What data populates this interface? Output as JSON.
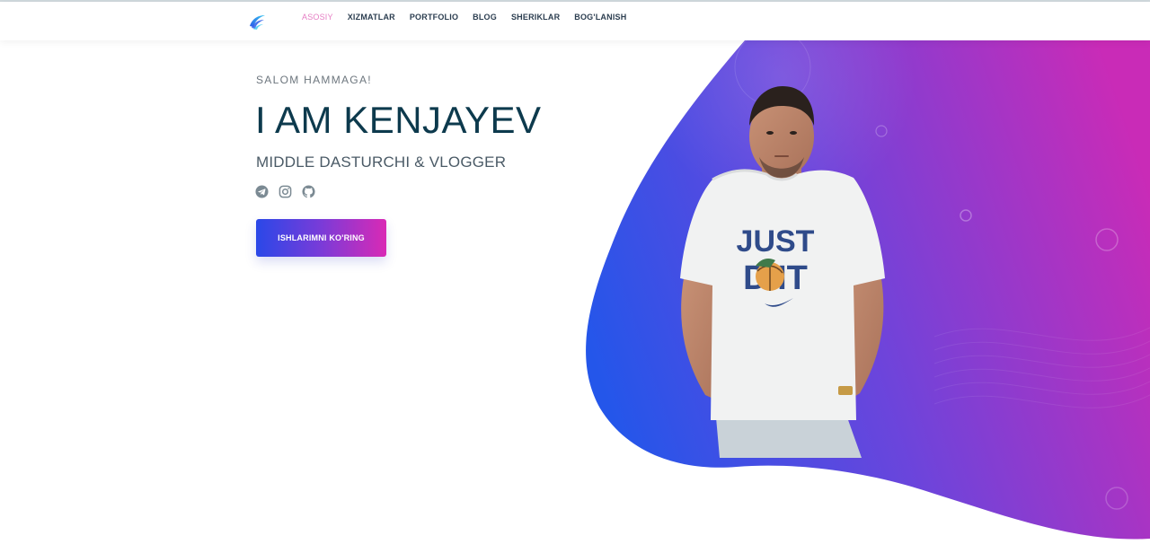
{
  "nav": {
    "logo_icon": "swoosh-logo",
    "items": [
      {
        "label": "ASOSIY",
        "active": true
      },
      {
        "label": "XIZMATLAR",
        "active": false
      },
      {
        "label": "PORTFOLIO",
        "active": false
      },
      {
        "label": "BLOG",
        "active": false
      },
      {
        "label": "SHERIKLAR",
        "active": false
      },
      {
        "label": "BOG'LANISH",
        "active": false
      }
    ]
  },
  "hero": {
    "greeting": "SALOM HAMMAGA!",
    "headline": "I AM KENJAYEV",
    "subtitle": "MIDDLE DASTURCHI & VLOGGER",
    "socials": [
      "telegram-icon",
      "instagram-icon",
      "github-icon"
    ],
    "cta_label": "ISHLARIMNI KO'RING",
    "shirt_text_top": "JUST",
    "shirt_text_bottom": "D IT"
  },
  "colors": {
    "gradient_start": "#2a5ae8",
    "gradient_mid": "#7a3bd8",
    "gradient_end": "#c42ab8",
    "heading": "#0d3a4d",
    "nav_active": "#e67ec4",
    "icon_gray": "#7b8a93"
  }
}
